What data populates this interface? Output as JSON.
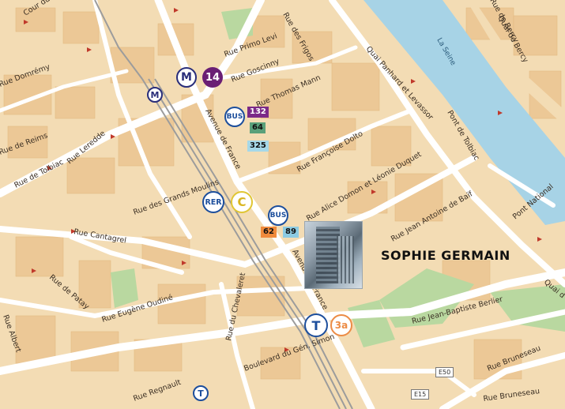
{
  "map": {
    "poi_label": "SOPHIE GERMAIN",
    "river_label": "La Seine",
    "streets": [
      "Rue de Tolbiac",
      "Rue Primo Levi",
      "Rue Thomas Mann",
      "Rue Françoise Dolto",
      "Rue Alice Domon et Léonie Duquet",
      "Rue Jean Antoine de Baïf",
      "Rue des Grands Moulins",
      "Rue Cantagrel",
      "Rue Eugène Oudiné",
      "Rue du Chevaleret",
      "Avenue de France",
      "Quai Panhard et Levassor",
      "Rue Jean-Baptiste Berlier",
      "Rue Bruneseau",
      "Rue Regnault",
      "Boulevard du Gén. Simon",
      "Pont de Tolbiac",
      "Pont National",
      "Quai de Bercy",
      "Rue des Frigos",
      "Rue Goscinny",
      "Rue Leredde",
      "Rue de Patay",
      "Cour du Liégat",
      "Rue Domrémy",
      "Rue de Reims",
      "Rue Albert",
      "Rue de Bercy",
      "Quai d"
    ],
    "road_refs": [
      "E50",
      "E15"
    ]
  },
  "transit": {
    "metro_symbol": "M",
    "metro_line": "14",
    "bus_symbol": "BUS",
    "bus_lines_north": [
      "132",
      "64",
      "325"
    ],
    "bus_lines_south": [
      "62",
      "89"
    ],
    "rer_symbol": "RER",
    "rer_line": "C",
    "tram_symbol": "T",
    "tram_line": "3a"
  },
  "colors": {
    "land": "#f3dcb4",
    "block": "#ecc896",
    "water": "#a7d3e6",
    "park": "#b9d8a0",
    "road": "#ffffff",
    "rail": "#9c9c9c",
    "line14": "#6a1e74",
    "bus132": "#7b2a88",
    "bus64": "#5aa07a",
    "bus325": "#a6d8e8",
    "bus62": "#f08a3c",
    "bus89": "#8ccbe2"
  }
}
